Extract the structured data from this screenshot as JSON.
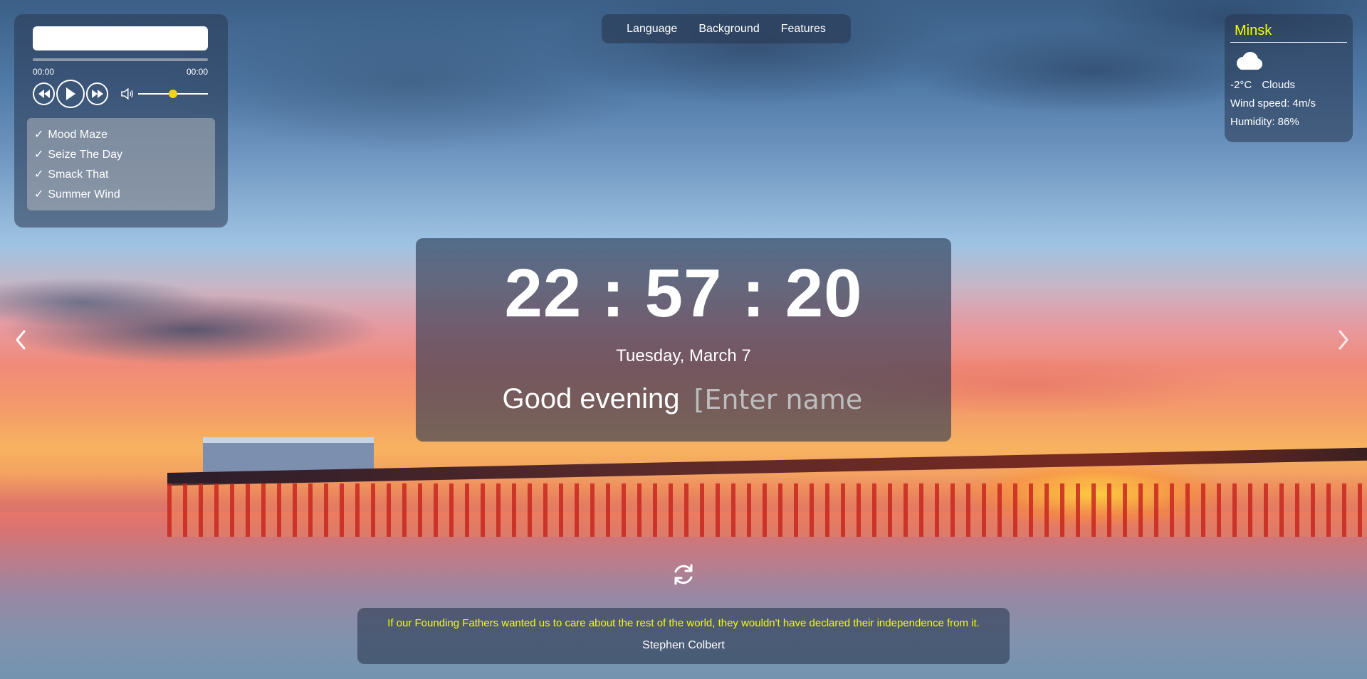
{
  "player": {
    "track_title": "",
    "current_time": "00:00",
    "duration": "00:00",
    "volume_level": 0.5,
    "playlist": [
      {
        "title": "Mood Maze",
        "mark": "✓"
      },
      {
        "title": "Seize The Day",
        "mark": "✓"
      },
      {
        "title": "Smack That",
        "mark": "✓"
      },
      {
        "title": "Summer Wind",
        "mark": "✓"
      }
    ],
    "icons": {
      "prev": "rewind-icon",
      "play": "play-icon",
      "next": "fast-forward-icon",
      "volume": "speaker-icon"
    }
  },
  "menu": {
    "language": "Language",
    "background": "Background",
    "features": "Features"
  },
  "weather": {
    "city": "Minsk",
    "icon": "cloud-icon",
    "temperature": "-2°C",
    "description": "Clouds",
    "wind": "Wind speed: 4m/s",
    "humidity": "Humidity: 86%"
  },
  "clock": {
    "time": "22 : 57 : 20",
    "date": "Tuesday, March 7",
    "greeting": "Good evening",
    "name_placeholder": "[Enter name]"
  },
  "quote": {
    "text": "If our Founding Fathers wanted us to care about the rest of the world, they wouldn't have declared their independence from it.",
    "author": "Stephen Colbert",
    "refresh_icon": "refresh-icon"
  },
  "colors": {
    "accent_yellow": "#f4ff00",
    "volume_knob": "#f4d215",
    "panel": "#283750"
  },
  "navigation": {
    "prev_icon": "chevron-left-icon",
    "next_icon": "chevron-right-icon"
  }
}
